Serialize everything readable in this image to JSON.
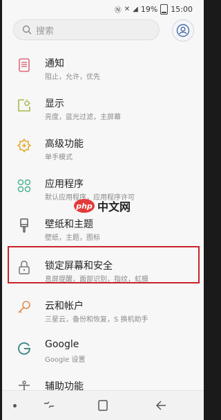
{
  "status": {
    "battery": "19%",
    "time": "15:00"
  },
  "search": {
    "placeholder": "搜索"
  },
  "settings": {
    "items": [
      {
        "title": "通知",
        "subtitle": "阻止，允许，优先",
        "icon": "notification-icon",
        "color": "#e06a7a"
      },
      {
        "title": "显示",
        "subtitle": "亮度，蓝光过滤，主屏幕",
        "icon": "display-icon",
        "color": "#a9b84a"
      },
      {
        "title": "高级功能",
        "subtitle": "单手模式",
        "icon": "advanced-features-icon",
        "color": "#e0a825"
      },
      {
        "title": "应用程序",
        "subtitle": "默认应用程序，应用程序许可",
        "icon": "apps-icon",
        "color": "#4db391"
      },
      {
        "title": "壁纸和主题",
        "subtitle": "壁纸，主题，图标",
        "icon": "wallpaper-icon",
        "color": "#5a5a5a"
      },
      {
        "title": "锁定屏幕和安全",
        "subtitle": "息屏提醒，面部识别，指纹，虹膜",
        "icon": "lock-icon",
        "color": "#777777"
      },
      {
        "title": "云和帐户",
        "subtitle": "三星云，备份和恢复，S 换机助手",
        "icon": "key-icon",
        "color": "#e08a48"
      },
      {
        "title": "Google",
        "subtitle": "Google 设置",
        "icon": "google-icon",
        "color": "#4a8a8a"
      },
      {
        "title": "辅助功能",
        "subtitle": "",
        "icon": "accessibility-icon",
        "color": "#666666"
      }
    ]
  },
  "watermark": {
    "badge": "php",
    "text": "中文网"
  }
}
